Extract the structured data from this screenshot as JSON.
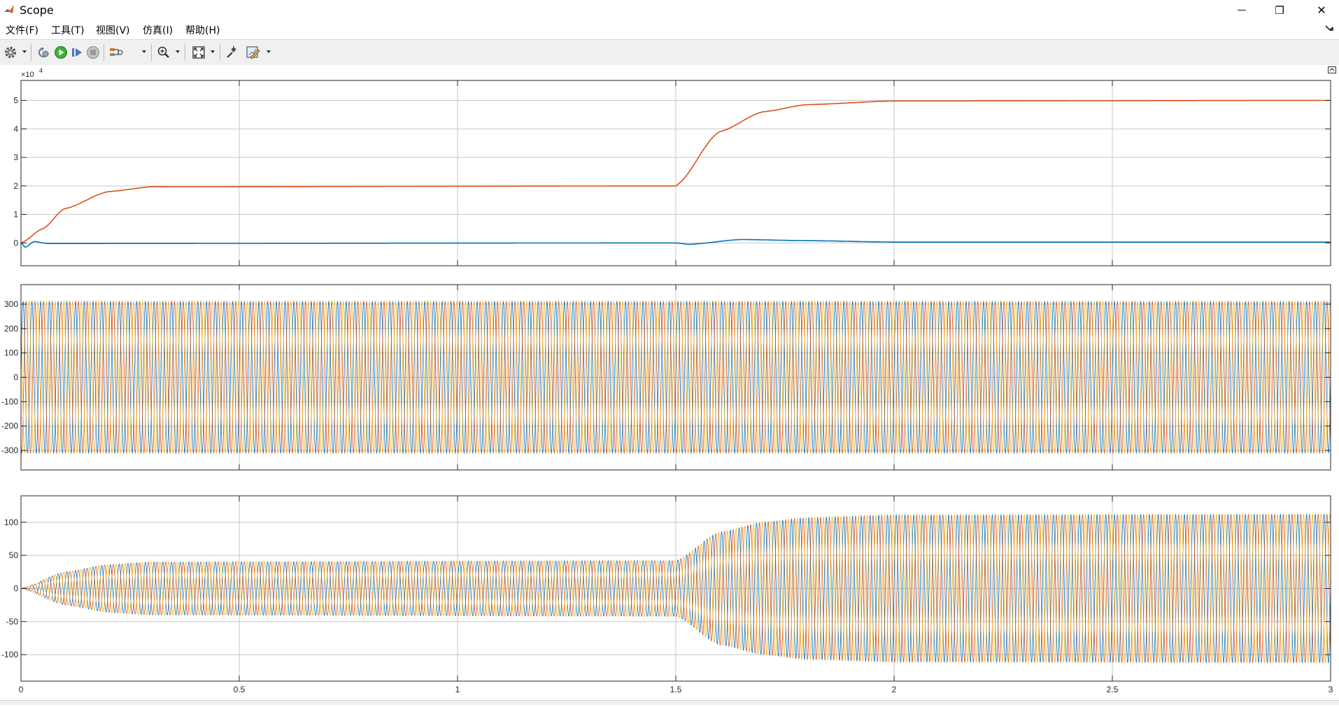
{
  "window": {
    "title": "Scope",
    "minimize_glyph": "—",
    "restore_glyph": "❐",
    "close_glyph": "✕"
  },
  "menu": {
    "items": [
      "文件(F)",
      "工具(T)",
      "视图(V)",
      "仿真(I)",
      "帮助(H)"
    ]
  },
  "toolbar": {
    "buttons": [
      {
        "icon": "gear-icon",
        "dropdown": true
      },
      {
        "icon": "step-back-icon"
      },
      {
        "icon": "run-icon"
      },
      {
        "icon": "step-forward-icon"
      },
      {
        "icon": "stop-icon"
      },
      {
        "icon": "signal-selector-icon",
        "dropdown": true
      },
      {
        "icon": "zoom-icon",
        "dropdown": true
      },
      {
        "icon": "autoscale-icon",
        "dropdown": true
      },
      {
        "icon": "tools-icon"
      },
      {
        "icon": "edit-style-icon",
        "dropdown": true
      }
    ]
  },
  "colors": {
    "series_blue": "#0072BD",
    "series_orange": "#D95319",
    "series_yellow": "#EDB120",
    "grid": "#c8c8c8",
    "axes_border": "#262626",
    "tick_text": "#262626"
  },
  "chart_data": [
    {
      "type": "line",
      "exponent_label": "×10",
      "exponent_power": "4",
      "x_range": [
        0,
        3
      ],
      "ylim": [
        -0.8,
        5.7
      ],
      "y_ticks": [
        0,
        1,
        2,
        3,
        4,
        5
      ],
      "y_tick_labels": [
        "0",
        "1",
        "2",
        "3",
        "4",
        "5"
      ],
      "x_ticks": [
        0,
        0.5,
        1,
        1.5,
        2,
        2.5,
        3
      ],
      "show_x_tick_labels": false,
      "grid": true,
      "series": [
        {
          "color": "#D95319",
          "description_points": [
            [
              0,
              0
            ],
            [
              0.05,
              0.5
            ],
            [
              0.1,
              1.2
            ],
            [
              0.2,
              1.8
            ],
            [
              0.3,
              1.97
            ],
            [
              1.5,
              2.0
            ],
            [
              1.6,
              3.9
            ],
            [
              1.7,
              4.6
            ],
            [
              1.8,
              4.85
            ],
            [
              2.0,
              4.98
            ],
            [
              3.0,
              5.0
            ]
          ]
        },
        {
          "color": "#0072BD",
          "description_points": [
            [
              0,
              0
            ],
            [
              0.01,
              -0.15
            ],
            [
              0.03,
              0.05
            ],
            [
              0.06,
              -0.02
            ],
            [
              1.5,
              0.0
            ],
            [
              1.53,
              -0.05
            ],
            [
              1.65,
              0.12
            ],
            [
              1.8,
              0.08
            ],
            [
              2.0,
              0.03
            ],
            [
              3.0,
              0.03
            ]
          ]
        }
      ]
    },
    {
      "type": "line",
      "x_range": [
        0,
        3
      ],
      "ylim": [
        -380,
        380
      ],
      "y_ticks": [
        -300,
        -200,
        -100,
        0,
        100,
        200,
        300
      ],
      "y_tick_labels": [
        "-300",
        "-200",
        "-100",
        "0",
        "100",
        "200",
        "300"
      ],
      "x_ticks": [
        0,
        0.5,
        1,
        1.5,
        2,
        2.5,
        3
      ],
      "show_x_tick_labels": false,
      "grid": true,
      "series_kind": "three-phase sinusoid",
      "amplitude": 311,
      "frequency_hz": 50,
      "series": [
        {
          "color": "#0072BD",
          "phase_deg": 0
        },
        {
          "color": "#D95319",
          "phase_deg": -120
        },
        {
          "color": "#EDB120",
          "phase_deg": 120
        }
      ]
    },
    {
      "type": "line",
      "x_range": [
        0,
        3
      ],
      "ylim": [
        -140,
        140
      ],
      "y_ticks": [
        -100,
        -50,
        0,
        50,
        100
      ],
      "y_tick_labels": [
        "-100",
        "-50",
        "0",
        "50",
        "100"
      ],
      "x_ticks": [
        0,
        0.5,
        1,
        1.5,
        2,
        2.5,
        3
      ],
      "x_tick_labels": [
        "0",
        "0.5",
        "1",
        "1.5",
        "2",
        "2.5",
        "3"
      ],
      "show_x_tick_labels": true,
      "grid": true,
      "series_kind": "three-phase sinusoid",
      "frequency_hz": 50,
      "amplitude_envelope": [
        [
          0,
          0
        ],
        [
          0.1,
          25
        ],
        [
          0.2,
          36
        ],
        [
          0.3,
          40
        ],
        [
          1.5,
          42
        ],
        [
          1.6,
          85
        ],
        [
          1.7,
          100
        ],
        [
          1.8,
          107
        ],
        [
          2.0,
          111
        ],
        [
          3.0,
          112
        ]
      ],
      "series": [
        {
          "color": "#0072BD",
          "phase_deg": 0
        },
        {
          "color": "#D95319",
          "phase_deg": -120
        },
        {
          "color": "#EDB120",
          "phase_deg": 120
        }
      ]
    }
  ]
}
